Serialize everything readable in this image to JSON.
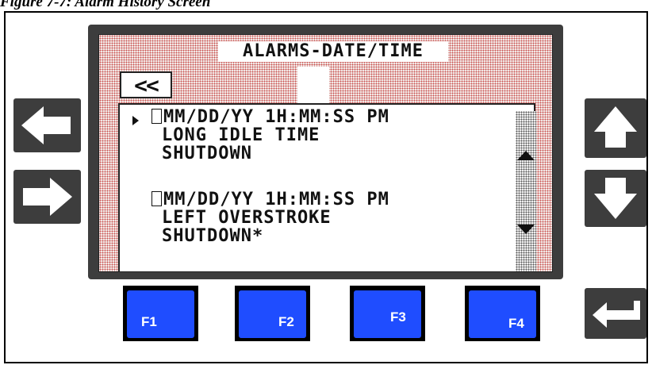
{
  "caption": "Figure 7-7: Alarm History Screen",
  "screen": {
    "title": "ALARMS-DATE/TIME",
    "back_label": "<<",
    "alarms": [
      {
        "lines": [
          "MM/DD/YY 1H:MM:SS PM",
          "LONG IDLE TIME",
          "SHUTDOWN"
        ],
        "selected": true
      },
      {
        "lines": [
          "MM/DD/YY 1H:MM:SS PM",
          "LEFT OVERSTROKE",
          "SHUTDOWN*"
        ],
        "selected": false
      }
    ]
  },
  "function_keys": [
    "F1",
    "F2",
    "F3",
    "F4"
  ],
  "colors": {
    "function_key": "#1f4dff",
    "bezel": "#3d3d3d",
    "lcd_dots": "#c9504e"
  },
  "icons": [
    "left-arrow-icon",
    "right-arrow-icon",
    "up-arrow-icon",
    "down-arrow-icon",
    "enter-icon"
  ]
}
